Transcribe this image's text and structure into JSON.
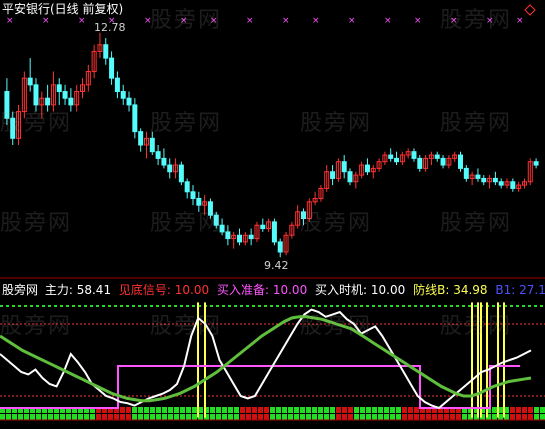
{
  "price_panel": {
    "title": "平安银行(日线 前复权)",
    "high_label": "12.78",
    "low_label": "9.42",
    "colors": {
      "up": "#ff3232",
      "down": "#54fcfc",
      "title": "#ffffff",
      "markers": "#ff55ff"
    }
  },
  "indicator_panel": {
    "name": "股旁网",
    "items": [
      {
        "label": "主力:",
        "value": "58.41",
        "color": "#ffffff"
      },
      {
        "label": "见底信号:",
        "value": "10.00",
        "color": "#ff3232"
      },
      {
        "label": "买入准备:",
        "value": "10.00",
        "color": "#ff55ff"
      },
      {
        "label": "买入时机:",
        "value": "10.00",
        "color": "#ffffff"
      },
      {
        "label": "防线B:",
        "value": "34.98",
        "color": "#ffff54"
      },
      {
        "label": "B1:",
        "value": "27.15",
        "color": "#5050ff"
      }
    ]
  },
  "watermark": "股旁网",
  "chart_data": {
    "type": "candlestick",
    "ohlc": [
      [
        11.9,
        12.1,
        11.4,
        11.5
      ],
      [
        11.5,
        11.6,
        11.1,
        11.2
      ],
      [
        11.2,
        11.7,
        11.1,
        11.6
      ],
      [
        11.6,
        12.2,
        11.5,
        12.1
      ],
      [
        12.1,
        12.4,
        11.9,
        12.0
      ],
      [
        12.0,
        12.1,
        11.6,
        11.7
      ],
      [
        11.7,
        11.9,
        11.5,
        11.8
      ],
      [
        11.8,
        12.0,
        11.6,
        11.7
      ],
      [
        11.7,
        12.2,
        11.6,
        12.0
      ],
      [
        12.0,
        12.1,
        11.7,
        11.9
      ],
      [
        11.9,
        12.0,
        11.7,
        11.8
      ],
      [
        11.8,
        11.95,
        11.6,
        11.7
      ],
      [
        11.7,
        12.0,
        11.6,
        11.9
      ],
      [
        11.9,
        12.1,
        11.8,
        12.0
      ],
      [
        12.0,
        12.3,
        11.9,
        12.2
      ],
      [
        12.2,
        12.6,
        12.1,
        12.5
      ],
      [
        12.5,
        12.78,
        12.4,
        12.6
      ],
      [
        12.6,
        12.7,
        12.3,
        12.4
      ],
      [
        12.4,
        12.5,
        12.0,
        12.1
      ],
      [
        12.1,
        12.2,
        11.8,
        11.9
      ],
      [
        11.9,
        12.0,
        11.7,
        11.8
      ],
      [
        11.8,
        11.9,
        11.6,
        11.7
      ],
      [
        11.7,
        11.8,
        11.2,
        11.3
      ],
      [
        11.3,
        11.35,
        11.0,
        11.1
      ],
      [
        11.1,
        11.3,
        10.9,
        11.2
      ],
      [
        11.2,
        11.3,
        10.95,
        11.0
      ],
      [
        11.0,
        11.1,
        10.8,
        10.9
      ],
      [
        10.9,
        11.05,
        10.75,
        10.8
      ],
      [
        10.8,
        10.9,
        10.6,
        10.7
      ],
      [
        10.7,
        10.9,
        10.6,
        10.8
      ],
      [
        10.8,
        10.85,
        10.5,
        10.55
      ],
      [
        10.55,
        10.6,
        10.3,
        10.4
      ],
      [
        10.4,
        10.5,
        10.2,
        10.3
      ],
      [
        10.3,
        10.4,
        10.1,
        10.2
      ],
      [
        10.2,
        10.35,
        10.05,
        10.25
      ],
      [
        10.25,
        10.3,
        10.0,
        10.05
      ],
      [
        10.05,
        10.1,
        9.85,
        9.9
      ],
      [
        9.9,
        10.0,
        9.75,
        9.8
      ],
      [
        9.8,
        9.9,
        9.6,
        9.7
      ],
      [
        9.7,
        9.8,
        9.55,
        9.75
      ],
      [
        9.75,
        9.85,
        9.6,
        9.65
      ],
      [
        9.65,
        9.8,
        9.6,
        9.75
      ],
      [
        9.75,
        9.85,
        9.6,
        9.7
      ],
      [
        9.7,
        9.95,
        9.65,
        9.9
      ],
      [
        9.9,
        10.0,
        9.8,
        9.85
      ],
      [
        9.85,
        10.0,
        9.8,
        9.95
      ],
      [
        9.95,
        10.0,
        9.6,
        9.65
      ],
      [
        9.65,
        9.7,
        9.42,
        9.5
      ],
      [
        9.5,
        9.8,
        9.45,
        9.75
      ],
      [
        9.75,
        9.95,
        9.7,
        9.9
      ],
      [
        9.9,
        10.2,
        9.85,
        10.1
      ],
      [
        10.1,
        10.15,
        9.9,
        10.0
      ],
      [
        10.0,
        10.3,
        9.95,
        10.25
      ],
      [
        10.25,
        10.4,
        10.2,
        10.3
      ],
      [
        10.3,
        10.5,
        10.25,
        10.45
      ],
      [
        10.45,
        10.8,
        10.4,
        10.7
      ],
      [
        10.7,
        10.8,
        10.5,
        10.6
      ],
      [
        10.6,
        10.9,
        10.55,
        10.85
      ],
      [
        10.85,
        10.95,
        10.6,
        10.7
      ],
      [
        10.7,
        10.75,
        10.5,
        10.55
      ],
      [
        10.55,
        10.7,
        10.45,
        10.65
      ],
      [
        10.65,
        10.85,
        10.6,
        10.8
      ],
      [
        10.8,
        10.9,
        10.65,
        10.7
      ],
      [
        10.7,
        10.8,
        10.6,
        10.75
      ],
      [
        10.75,
        10.9,
        10.7,
        10.85
      ],
      [
        10.85,
        11.0,
        10.8,
        10.95
      ],
      [
        10.95,
        11.05,
        10.85,
        10.9
      ],
      [
        10.9,
        11.0,
        10.8,
        10.85
      ],
      [
        10.85,
        11.0,
        10.8,
        10.95
      ],
      [
        10.95,
        11.05,
        10.9,
        11.0
      ],
      [
        11.0,
        11.05,
        10.85,
        10.9
      ],
      [
        10.9,
        10.95,
        10.7,
        10.75
      ],
      [
        10.75,
        10.95,
        10.7,
        10.9
      ],
      [
        10.9,
        11.0,
        10.8,
        10.95
      ],
      [
        10.95,
        11.0,
        10.85,
        10.9
      ],
      [
        10.9,
        10.95,
        10.75,
        10.8
      ],
      [
        10.8,
        10.95,
        10.75,
        10.9
      ],
      [
        10.9,
        11.0,
        10.85,
        10.95
      ],
      [
        10.95,
        11.0,
        10.7,
        10.75
      ],
      [
        10.75,
        10.8,
        10.55,
        10.6
      ],
      [
        10.6,
        10.7,
        10.5,
        10.65
      ],
      [
        10.65,
        10.75,
        10.55,
        10.6
      ],
      [
        10.6,
        10.65,
        10.5,
        10.55
      ],
      [
        10.55,
        10.65,
        10.45,
        10.6
      ],
      [
        10.6,
        10.7,
        10.5,
        10.55
      ],
      [
        10.55,
        10.6,
        10.45,
        10.5
      ],
      [
        10.5,
        10.6,
        10.45,
        10.55
      ],
      [
        10.55,
        10.6,
        10.4,
        10.45
      ],
      [
        10.45,
        10.55,
        10.4,
        10.5
      ],
      [
        10.5,
        10.6,
        10.45,
        10.55
      ],
      [
        10.55,
        10.9,
        10.5,
        10.85
      ],
      [
        10.85,
        10.9,
        10.75,
        10.8
      ]
    ],
    "price_ylim": [
      9.2,
      13.0
    ],
    "indicator_series": [
      {
        "name": "主力",
        "color": "#ffffff",
        "values": [
          55,
          50,
          45,
          40,
          38,
          42,
          35,
          30,
          28,
          40,
          55,
          48,
          40,
          30,
          25,
          20,
          18,
          15,
          14,
          12,
          15,
          18,
          20,
          22,
          25,
          30,
          45,
          70,
          85,
          80,
          70,
          50,
          40,
          30,
          20,
          18,
          20,
          30,
          40,
          50,
          60,
          70,
          80,
          88,
          92,
          90,
          86,
          88,
          90,
          84,
          80,
          72,
          75,
          78,
          70,
          60,
          50,
          40,
          30,
          20,
          15,
          12,
          10,
          15,
          20,
          25,
          30,
          35,
          40,
          42,
          45,
          48,
          50,
          52,
          55,
          58
        ]
      },
      {
        "name": "防线B",
        "color": "#5fbe3c",
        "values": [
          70,
          66,
          62,
          58,
          55,
          52,
          49,
          46,
          43,
          40,
          37,
          34,
          31,
          28,
          25,
          22,
          20,
          18,
          17,
          16,
          16,
          17,
          18,
          20,
          22,
          25,
          28,
          32,
          36,
          40,
          45,
          50,
          55,
          60,
          65,
          70,
          74,
          78,
          82,
          85,
          86,
          86,
          85,
          84,
          82,
          80,
          78,
          76,
          72,
          68,
          64,
          60,
          56,
          52,
          48,
          44,
          40,
          36,
          32,
          28,
          25,
          22,
          20,
          20,
          22,
          25,
          28,
          30,
          32,
          33,
          34,
          34.98
        ]
      }
    ],
    "reference_levels": [
      80,
      20
    ]
  }
}
